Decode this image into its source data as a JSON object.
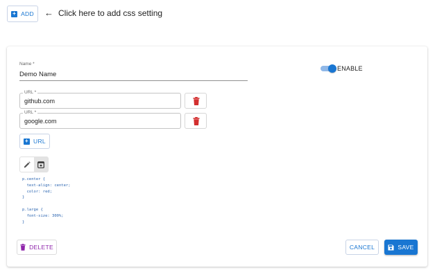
{
  "toolbar": {
    "add_label": "ADD",
    "add_icon": "plus-box-icon"
  },
  "hint": {
    "arrow": "←",
    "text": "Click here to add css setting"
  },
  "form": {
    "name_label": "Name *",
    "name_value": "Demo Name",
    "enable_label": "ENABLE",
    "enabled": true,
    "urls": [
      {
        "label": "URL *",
        "value": "github.com"
      },
      {
        "label": "URL *",
        "value": "google.com"
      }
    ],
    "add_url_label": "URL",
    "css_code": "p.center {\n  text-align: center;\n  color: red;\n}\n\np.large {\n  font-size: 300%;\n}"
  },
  "actions": {
    "delete_label": "DELETE",
    "cancel_label": "CANCEL",
    "save_label": "SAVE"
  },
  "colors": {
    "primary": "#1976d2",
    "danger": "#d32f2f",
    "delete": "#8e24aa"
  }
}
